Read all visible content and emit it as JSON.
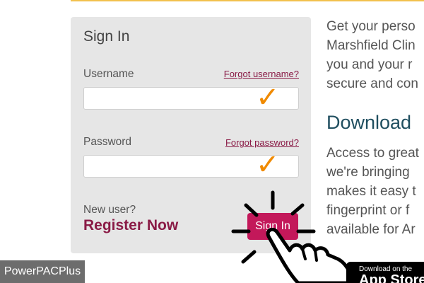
{
  "signin": {
    "title": "Sign In",
    "username_label": "Username",
    "forgot_username": "Forgot username?",
    "username_value": "",
    "password_label": "Password",
    "forgot_password": "Forgot password?",
    "password_value": "",
    "new_user_label": "New user?",
    "register_label": "Register Now",
    "signin_button": "Sign In"
  },
  "right": {
    "intro_lines": [
      "Get your perso",
      "Marshfield Clin",
      "you and your r",
      "secure and con"
    ],
    "download_heading": "Download",
    "download_lines": [
      "Access to great",
      "we're bringing",
      "makes it easy t",
      "fingerprint or f",
      "available for Ar"
    ]
  },
  "badge": {
    "small": "Download on the",
    "big": "App Store"
  },
  "watermark": "PowerPACPlus",
  "colors": {
    "accent": "#c3185a",
    "link": "#8a1b46",
    "heading": "#1f4e5f",
    "checkmark": "#f08a00",
    "card": "#e6e6e6"
  },
  "icons": {
    "checkmark": "checkmark-icon",
    "burst": "click-burst-icon",
    "hand": "pointing-hand-icon"
  }
}
